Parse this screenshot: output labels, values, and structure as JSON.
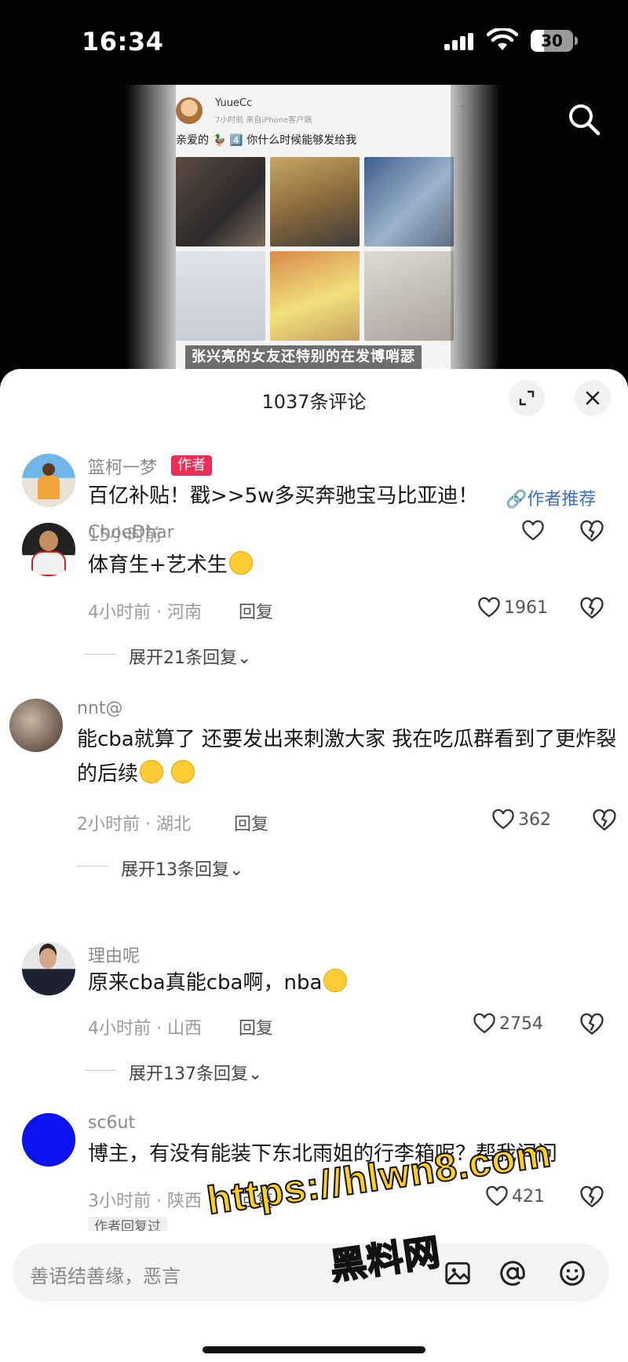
{
  "status_bar": {
    "time": "16:34",
    "battery": "30"
  },
  "video": {
    "post_user": "YuueCc",
    "post_meta": "7小时前 来自iPhone客户端",
    "post_text": "亲爱的 🦆 4️⃣ 你什么时候能够发给我",
    "caption": "张兴亮的女友还特别的在发博哨瑟",
    "search_icon": "search-icon"
  },
  "sheet": {
    "title": "1037条评论",
    "fullscreen_icon": "expand-icon",
    "close_icon": "close-icon"
  },
  "comments": [
    {
      "user": "篮柯一梦",
      "badge": "作者",
      "text": "百亿补贴！戳>>5w多买奔驰宝马比亚迪！",
      "recommend": "🔗作者推荐",
      "meta": "15小时前",
      "likes": ""
    },
    {
      "user": "ChoeDhar",
      "text": "体育生+艺术生",
      "meta": "4小时前 · 河南",
      "reply": "回复",
      "likes": "1961",
      "expand": "展开21条回复⌄"
    },
    {
      "user": "nnt@",
      "text": "能cba就算了 还要发出来刺激大家 我在吃瓜群看到了更炸裂的后续",
      "meta": "2小时前 · 湖北",
      "reply": "回复",
      "likes": "362",
      "expand": "展开13条回复⌄"
    },
    {
      "user": "理由呢",
      "text": "原来cba真能cba啊，nba",
      "meta": "4小时前 · 山西",
      "reply": "回复",
      "likes": "2754",
      "expand": "展开137条回复⌄"
    },
    {
      "user": "sc6ut",
      "text": "博主，有没有能装下东北雨姐的行李箱呢？帮我问问",
      "meta": "3小时前 · 陕西",
      "reply": "回复",
      "likes": "421",
      "tag": "作者回复过"
    }
  ],
  "input": {
    "placeholder": "善语结善缘，恶言",
    "image_icon": "image-icon",
    "mention_icon": "at-icon",
    "emoji_icon": "emoji-icon"
  },
  "watermark": {
    "line1": "https://hlwn8.com",
    "line2": "黑料网"
  },
  "colors": {
    "author_badge": "#ef2d56",
    "link": "#3d6bd6",
    "watermark": "#ffcf1a"
  }
}
